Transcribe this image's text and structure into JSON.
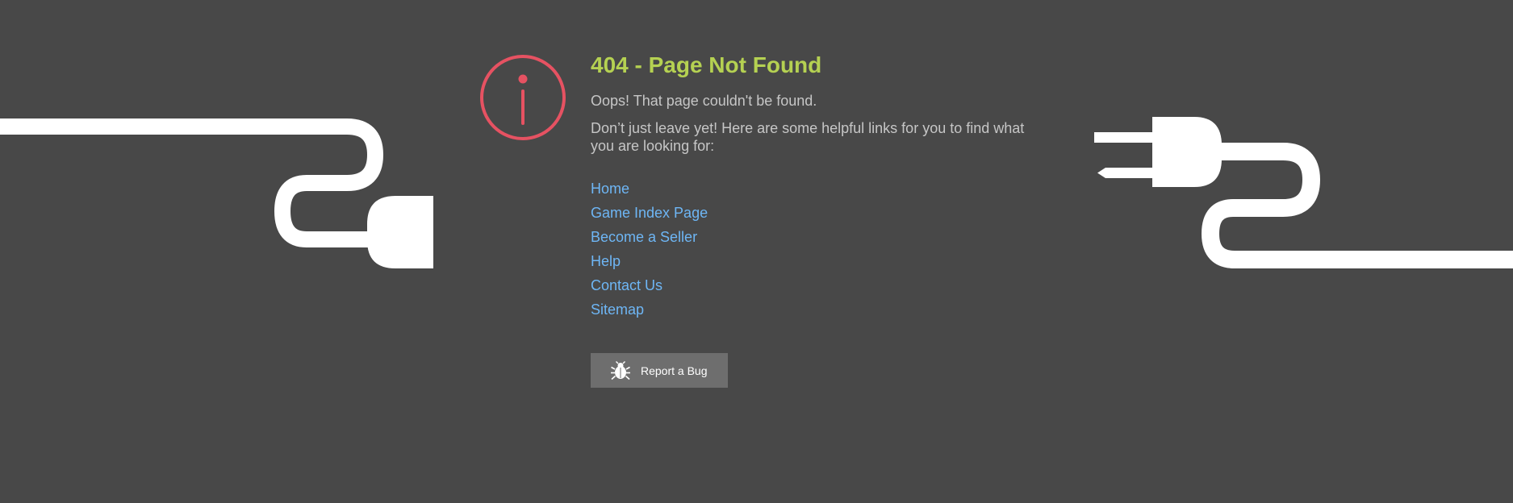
{
  "page": {
    "background_color": "#484848"
  },
  "error": {
    "title": "404 - Page Not Found",
    "subtitle": "Oops! That page couldn't be found.",
    "helper_text": "Don’t just leave yet! Here are some helpful links for you to find what you are looking for:",
    "title_color": "#b5d152",
    "icon": "info-circle-icon",
    "icon_color": "#e65262"
  },
  "links": [
    {
      "label": "Home"
    },
    {
      "label": "Game Index Page"
    },
    {
      "label": "Become a Seller"
    },
    {
      "label": "Help"
    },
    {
      "label": "Contact Us"
    },
    {
      "label": "Sitemap"
    }
  ],
  "link_color": "#6eb6f5",
  "report_bug": {
    "label": "Report a Bug",
    "icon": "bug-icon"
  },
  "decorations": {
    "left": "unplugged-cable-socket-icon",
    "right": "unplugged-cable-plug-icon"
  }
}
